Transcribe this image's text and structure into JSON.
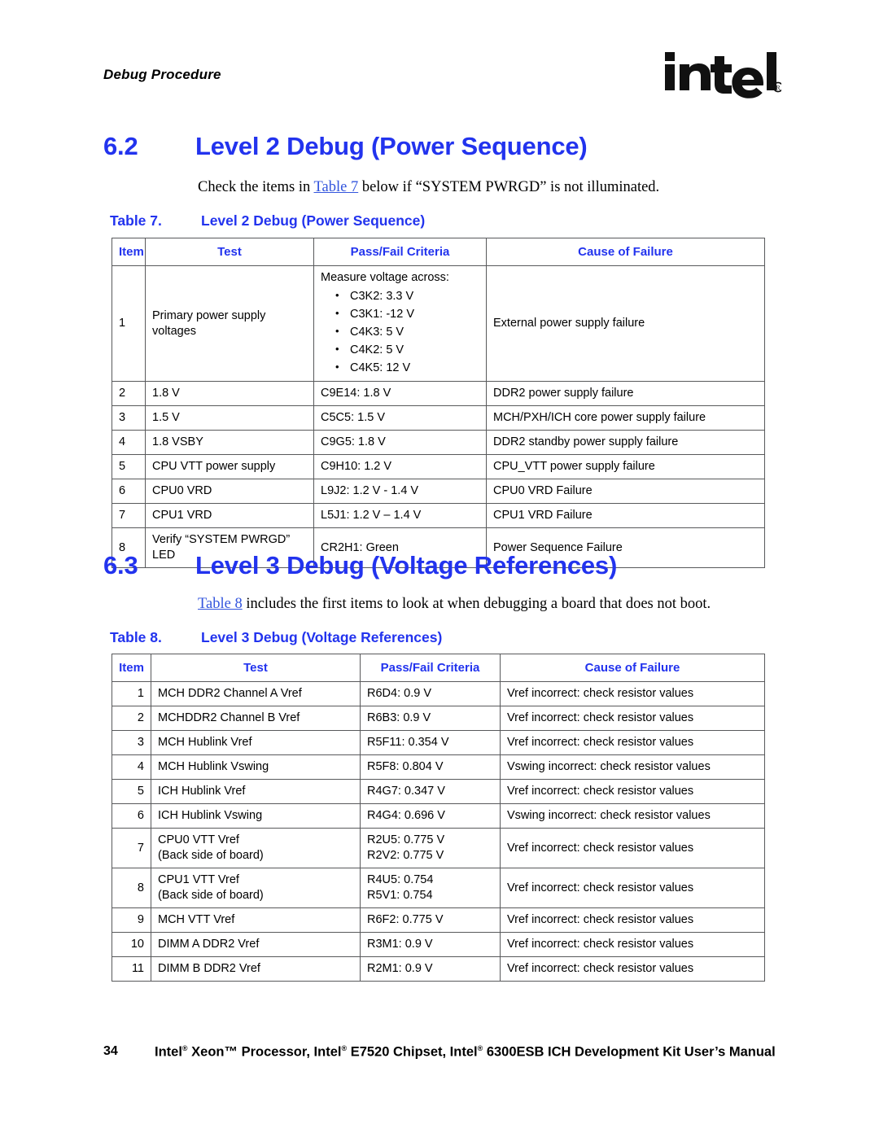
{
  "header": {
    "running_title": "Debug Procedure",
    "logo_text": "intel",
    "logo_mark": "registered-trademark"
  },
  "sections": [
    {
      "number": "6.2",
      "title": "Level 2 Debug (Power Sequence)",
      "intro_before": "Check the items in ",
      "intro_xref": "Table 7",
      "intro_after": " below if “SYSTEM PWRGD” is not illuminated.",
      "table_caption_num": "Table 7.",
      "table_caption_title": "Level 2 Debug (Power Sequence)"
    },
    {
      "number": "6.3",
      "title": "Level 3 Debug (Voltage References)",
      "intro_before": "",
      "intro_xref": "Table 8",
      "intro_after": " includes the first items to look at when debugging a board that does not boot.",
      "table_caption_num": "Table 8.",
      "table_caption_title": "Level 3 Debug (Voltage References)"
    }
  ],
  "table7": {
    "columns": [
      "Item",
      "Test",
      "Pass/Fail Criteria",
      "Cause of Failure"
    ],
    "rows": [
      {
        "item": "1",
        "test": "Primary power supply voltages",
        "criteria_lead": "Measure voltage across:",
        "criteria_bullets": [
          "C3K2:  3.3 V",
          "C3K1: -12 V",
          "C4K3: 5 V",
          "C4K2: 5 V",
          "C4K5: 12 V"
        ],
        "cause": "External power supply failure"
      },
      {
        "item": "2",
        "test": "1.8 V",
        "criteria": "C9E14: 1.8 V",
        "cause": "DDR2 power supply failure"
      },
      {
        "item": "3",
        "test": "1.5 V",
        "criteria": "C5C5: 1.5 V",
        "cause": "MCH/PXH/ICH core power supply failure"
      },
      {
        "item": "4",
        "test": "1.8 VSBY",
        "criteria": "C9G5: 1.8 V",
        "cause": "DDR2 standby power supply failure"
      },
      {
        "item": "5",
        "test": "CPU VTT power supply",
        "criteria": "C9H10: 1.2 V",
        "cause": "CPU_VTT power supply failure"
      },
      {
        "item": "6",
        "test": "CPU0 VRD",
        "criteria": "L9J2: 1.2 V - 1.4 V",
        "cause": "CPU0 VRD Failure"
      },
      {
        "item": "7",
        "test": "CPU1 VRD",
        "criteria": "L5J1: 1.2 V – 1.4 V",
        "cause": "CPU1 VRD Failure"
      },
      {
        "item": "8",
        "test": "Verify “SYSTEM PWRGD” LED",
        "criteria": "CR2H1: Green",
        "cause": "Power Sequence Failure"
      }
    ]
  },
  "table8": {
    "columns": [
      "Item",
      "Test",
      "Pass/Fail Criteria",
      "Cause of Failure"
    ],
    "rows": [
      {
        "item": "1",
        "test": "MCH DDR2 Channel A Vref",
        "criteria": "R6D4: 0.9 V",
        "cause": "Vref incorrect: check resistor values"
      },
      {
        "item": "2",
        "test": "MCHDDR2 Channel B Vref",
        "criteria": "R6B3: 0.9 V",
        "cause": "Vref incorrect: check resistor values"
      },
      {
        "item": "3",
        "test": "MCH Hublink Vref",
        "criteria": "R5F11: 0.354 V",
        "cause": "Vref incorrect: check resistor values"
      },
      {
        "item": "4",
        "test": "MCH Hublink Vswing",
        "criteria": "R5F8: 0.804 V",
        "cause": "Vswing incorrect: check resistor values"
      },
      {
        "item": "5",
        "test": "ICH Hublink Vref",
        "criteria": "R4G7: 0.347 V",
        "cause": "Vref incorrect: check resistor values"
      },
      {
        "item": "6",
        "test": "ICH Hublink Vswing",
        "criteria": "R4G4: 0.696 V",
        "cause": "Vswing incorrect: check resistor values"
      },
      {
        "item": "7",
        "test": "CPU0 VTT Vref",
        "test_sub": "(Back side of board)",
        "criteria": "R2U5: 0.775 V",
        "criteria_sub": "R2V2:  0.775 V",
        "cause": "Vref incorrect: check resistor values"
      },
      {
        "item": "8",
        "test": "CPU1 VTT Vref",
        "test_sub": "(Back side of board)",
        "criteria": "R4U5: 0.754",
        "criteria_sub": "R5V1: 0.754",
        "cause": "Vref incorrect: check resistor values"
      },
      {
        "item": "9",
        "test": "MCH VTT Vref",
        "criteria": "R6F2:  0.775 V",
        "cause": "Vref incorrect: check resistor values"
      },
      {
        "item": "10",
        "test": "DIMM A DDR2 Vref",
        "criteria": "R3M1: 0.9 V",
        "cause": "Vref incorrect: check resistor values"
      },
      {
        "item": "11",
        "test": "DIMM B DDR2 Vref",
        "criteria": "R2M1: 0.9 V",
        "cause": "Vref incorrect: check resistor values"
      }
    ]
  },
  "footer": {
    "page_number": "34",
    "text_part1": "Intel",
    "text_part2": " Xeon™ Processor, Intel",
    "text_part3": " E7520 Chipset, Intel",
    "text_part4": " 6300ESB ICH Development Kit User’s Manual"
  },
  "colors": {
    "heading_blue": "#2233ee",
    "xref_blue": "#3355dd",
    "table_border": "#58595b",
    "text_black": "#000000"
  }
}
